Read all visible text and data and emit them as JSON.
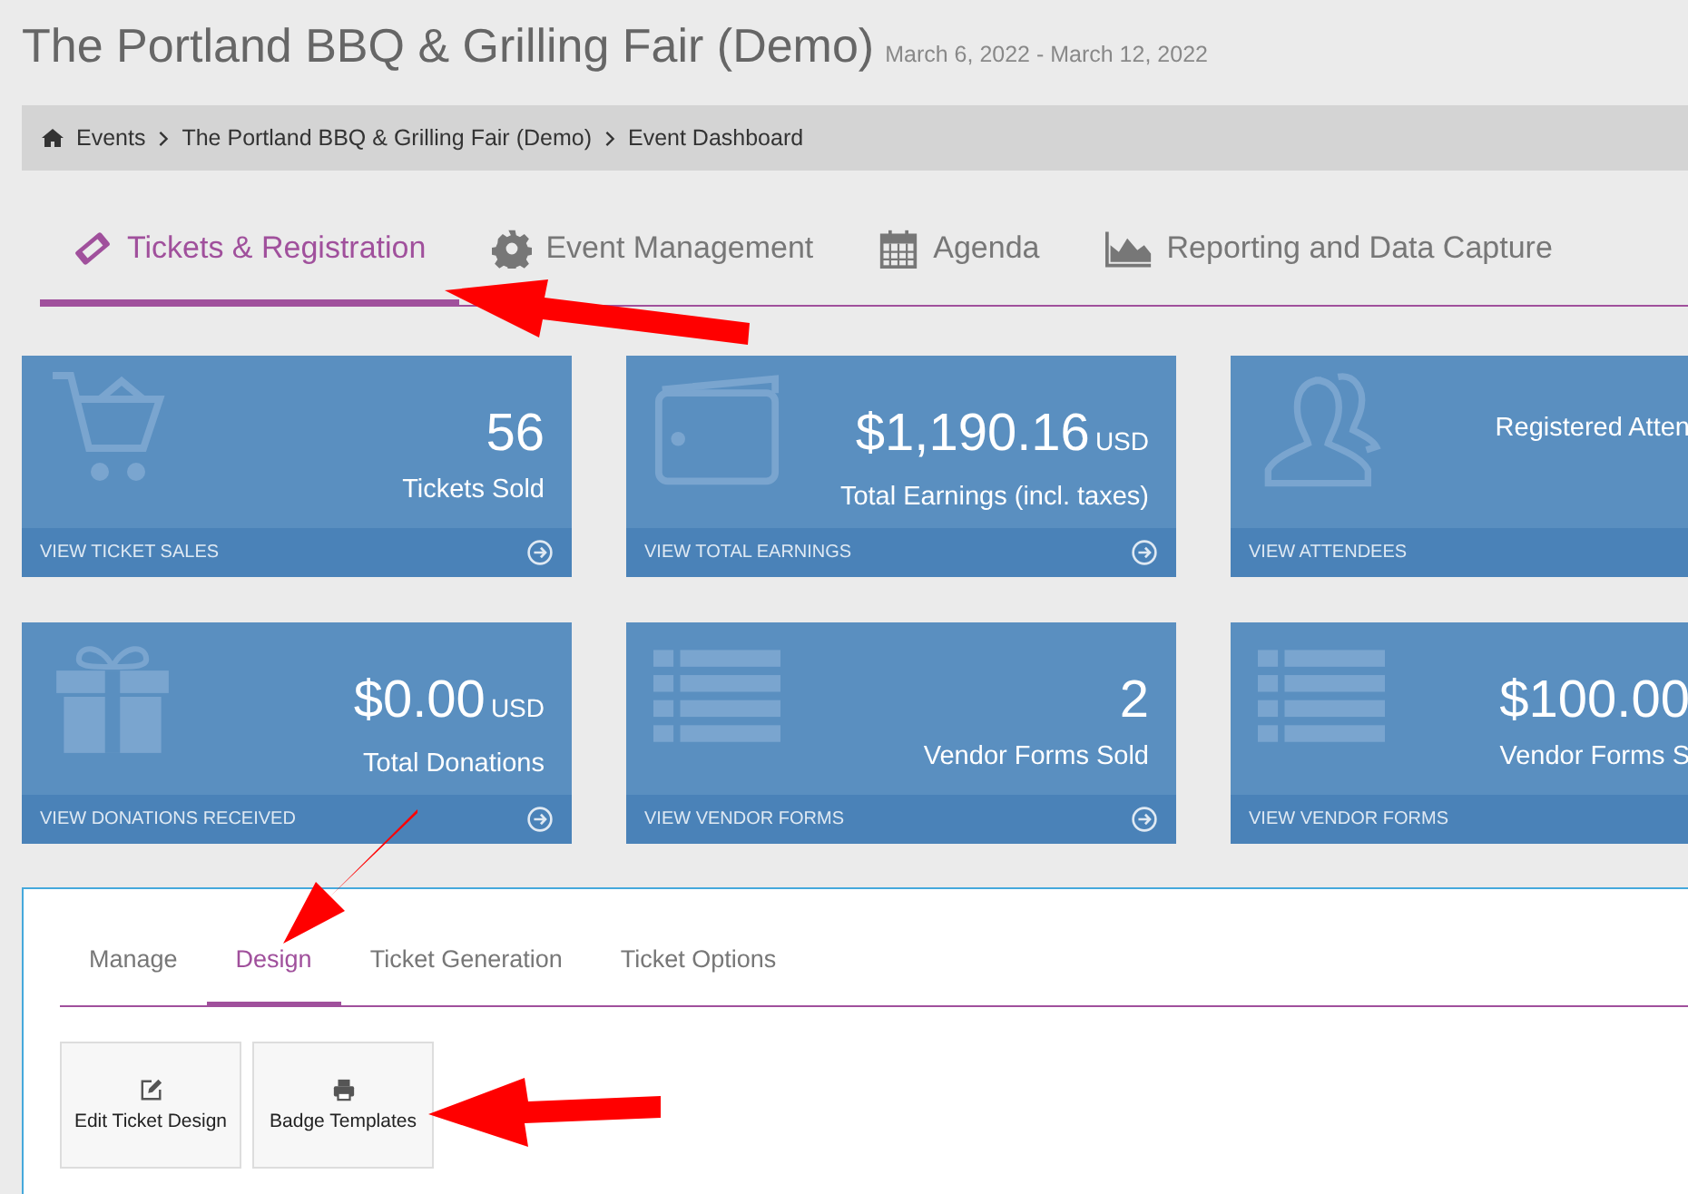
{
  "header": {
    "title": "The Portland BBQ & Grilling Fair (Demo)",
    "dates": "March 6, 2022 - March 12, 2022"
  },
  "breadcrumb": [
    "Events",
    "The Portland BBQ & Grilling Fair (Demo)",
    "Event Dashboard"
  ],
  "tabs": [
    {
      "label": "Tickets & Registration",
      "kind": "ticket",
      "selected": true
    },
    {
      "label": "Event Management",
      "kind": "gear",
      "selected": false
    },
    {
      "label": "Agenda",
      "kind": "calendar",
      "selected": false
    },
    {
      "label": "Reporting and Data Capture",
      "kind": "chart",
      "selected": false
    }
  ],
  "cards": [
    {
      "kind": "cart",
      "value": "56",
      "label": "Tickets Sold",
      "link": "VIEW TICKET SALES"
    },
    {
      "kind": "wallet",
      "value": "$1,190.16",
      "unit": "USD",
      "label": "Total Earnings (incl. taxes)",
      "link": "VIEW TOTAL EARNINGS"
    },
    {
      "kind": "user",
      "label": "Registered Atten",
      "link": "VIEW ATTENDEES"
    },
    {
      "kind": "gift",
      "value": "$0.00",
      "unit": "USD",
      "label": "Total Donations",
      "link": "VIEW DONATIONS RECEIVED"
    },
    {
      "kind": "list",
      "value": "2",
      "label": "Vendor Forms Sold",
      "link": "VIEW VENDOR FORMS"
    },
    {
      "kind": "list",
      "value": "$100.00",
      "label": "Vendor Forms S",
      "link": "VIEW VENDOR FORMS"
    }
  ],
  "subtabs": [
    {
      "label": "Manage",
      "selected": false
    },
    {
      "label": "Design",
      "selected": true
    },
    {
      "label": "Ticket Generation",
      "selected": false
    },
    {
      "label": "Ticket Options",
      "selected": false
    }
  ],
  "actions": [
    {
      "label": "Edit Ticket Design",
      "kind": "edit"
    },
    {
      "label": "Badge Templates",
      "kind": "print"
    }
  ]
}
